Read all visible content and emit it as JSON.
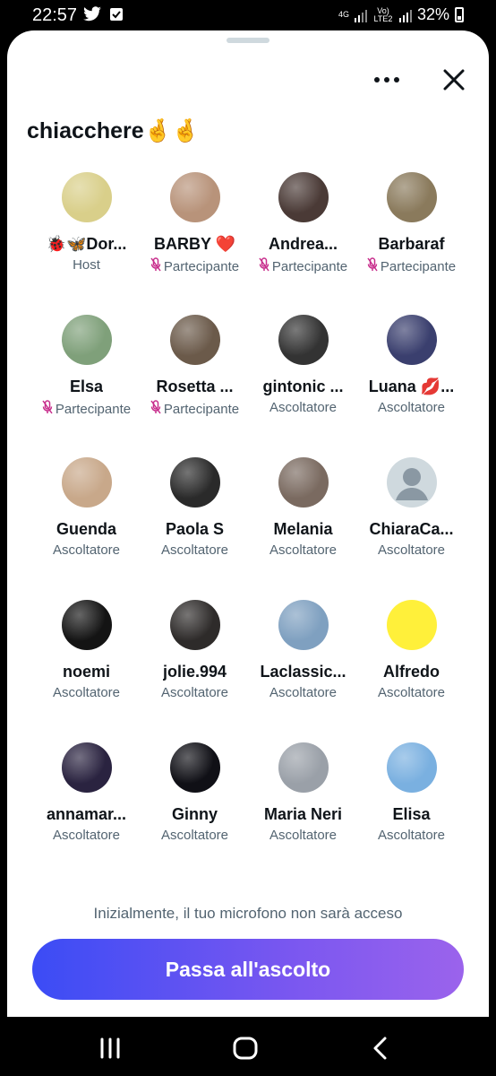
{
  "status_bar": {
    "time": "22:57",
    "network_label": "4G",
    "volte_label": "Vo) LTE2",
    "battery": "32%"
  },
  "space": {
    "title": "chiacchere🤞🤞"
  },
  "participants": [
    {
      "name": "🐞🦋Dor...",
      "role": "Host",
      "mic": false
    },
    {
      "name": "BARBY ❤️",
      "role": "Partecipante",
      "mic": true
    },
    {
      "name": "Andrea...",
      "role": "Partecipante",
      "mic": true
    },
    {
      "name": "Barbaraf",
      "role": "Partecipante",
      "mic": true
    },
    {
      "name": "Elsa",
      "role": "Partecipante",
      "mic": true
    },
    {
      "name": "Rosetta ...",
      "role": "Partecipante",
      "mic": true
    },
    {
      "name": "gintonic ...",
      "role": "Ascoltatore",
      "mic": false
    },
    {
      "name": "Luana 💋...",
      "role": "Ascoltatore",
      "mic": false
    },
    {
      "name": "Guenda",
      "role": "Ascoltatore",
      "mic": false
    },
    {
      "name": "Paola S",
      "role": "Ascoltatore",
      "mic": false
    },
    {
      "name": "Melania",
      "role": "Ascoltatore",
      "mic": false
    },
    {
      "name": "ChiaraCa...",
      "role": "Ascoltatore",
      "mic": false
    },
    {
      "name": "noemi",
      "role": "Ascoltatore",
      "mic": false
    },
    {
      "name": "jolie.994",
      "role": "Ascoltatore",
      "mic": false
    },
    {
      "name": "Laclassic...",
      "role": "Ascoltatore",
      "mic": false
    },
    {
      "name": "Alfredo",
      "role": "Ascoltatore",
      "mic": false
    },
    {
      "name": "annamar...",
      "role": "Ascoltatore",
      "mic": false
    },
    {
      "name": "Ginny",
      "role": "Ascoltatore",
      "mic": false
    },
    {
      "name": "Maria Neri",
      "role": "Ascoltatore",
      "mic": false
    },
    {
      "name": "Elisa",
      "role": "Ascoltatore",
      "mic": false
    }
  ],
  "avatar_colors": [
    "#d9cf8a",
    "#b8937a",
    "#4a3a36",
    "#8a7a5c",
    "#7fa07a",
    "#6b5a4a",
    "#333333",
    "#3a3f6e",
    "#c8a88a",
    "#2a2a2a",
    "#7a6a60",
    "#cfd9de",
    "#141414",
    "#2e2b2a",
    "#7fa0c0",
    "#fff03a",
    "#2a2340",
    "#101016",
    "#9aa0a8",
    "#7ab0e0"
  ],
  "mic_icon": "mic-icon",
  "footer": {
    "mic_note": "Inizialmente, il tuo microfono non sarà acceso",
    "cta_label": "Passa all'ascolto"
  },
  "colors": {
    "accent_start": "#3b4cf5",
    "accent_end": "#9b63ec",
    "mic_color": "#c72c8b"
  }
}
